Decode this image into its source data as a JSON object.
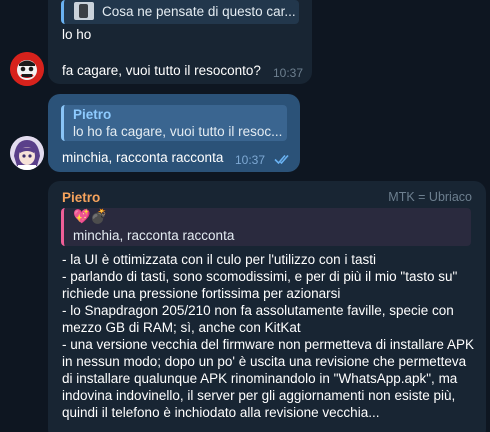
{
  "messages": {
    "first": {
      "reply_preview": "Cosa ne pensate di questo car...",
      "lines": [
        "lo ho",
        "fa cagare, vuoi tutto il resoconto?"
      ],
      "time": "10:37"
    },
    "second": {
      "reply_author": "Pietro",
      "reply_preview": "lo ho  fa cagare, vuoi tutto il resoc...",
      "text": "minchia, racconta racconta",
      "time": "10:37"
    },
    "third": {
      "author": "Pietro",
      "badge": "MTK = Ubriaco",
      "reply_emoji": "💖💣",
      "reply_preview": "minchia, racconta racconta",
      "body_lines": [
        "- la UI è ottimizzata con il culo per l'utilizzo con i tasti",
        "- parlando di tasti, sono scomodissimi, e per di più il mio \"tasto su\"",
        "richiede una pressione fortissima per azionarsi",
        "- lo Snapdragon 205/210 non fa assolutamente faville, specie con",
        "mezzo GB di RAM; sì, anche con KitKat",
        "- una versione vecchia del firmware non permetteva di installare APK",
        "in nessun modo; dopo un po' è uscita una revisione che permetteva",
        "di installare qualunque APK rinominandolo in \"WhatsApp.apk\", ma",
        "indovina indovinello, il server per gli aggiornamenti non esiste più,",
        "quindi il telefono è inchiodato alla revisione vecchia..."
      ]
    }
  },
  "colors": {
    "background": "#0e1621",
    "incoming_bubble": "#182533",
    "outgoing_bubble": "#2b5278",
    "accent_blue": "#6ab2f2",
    "author_orange": "#f6a35d",
    "pink_quote": "#ee5f97"
  }
}
